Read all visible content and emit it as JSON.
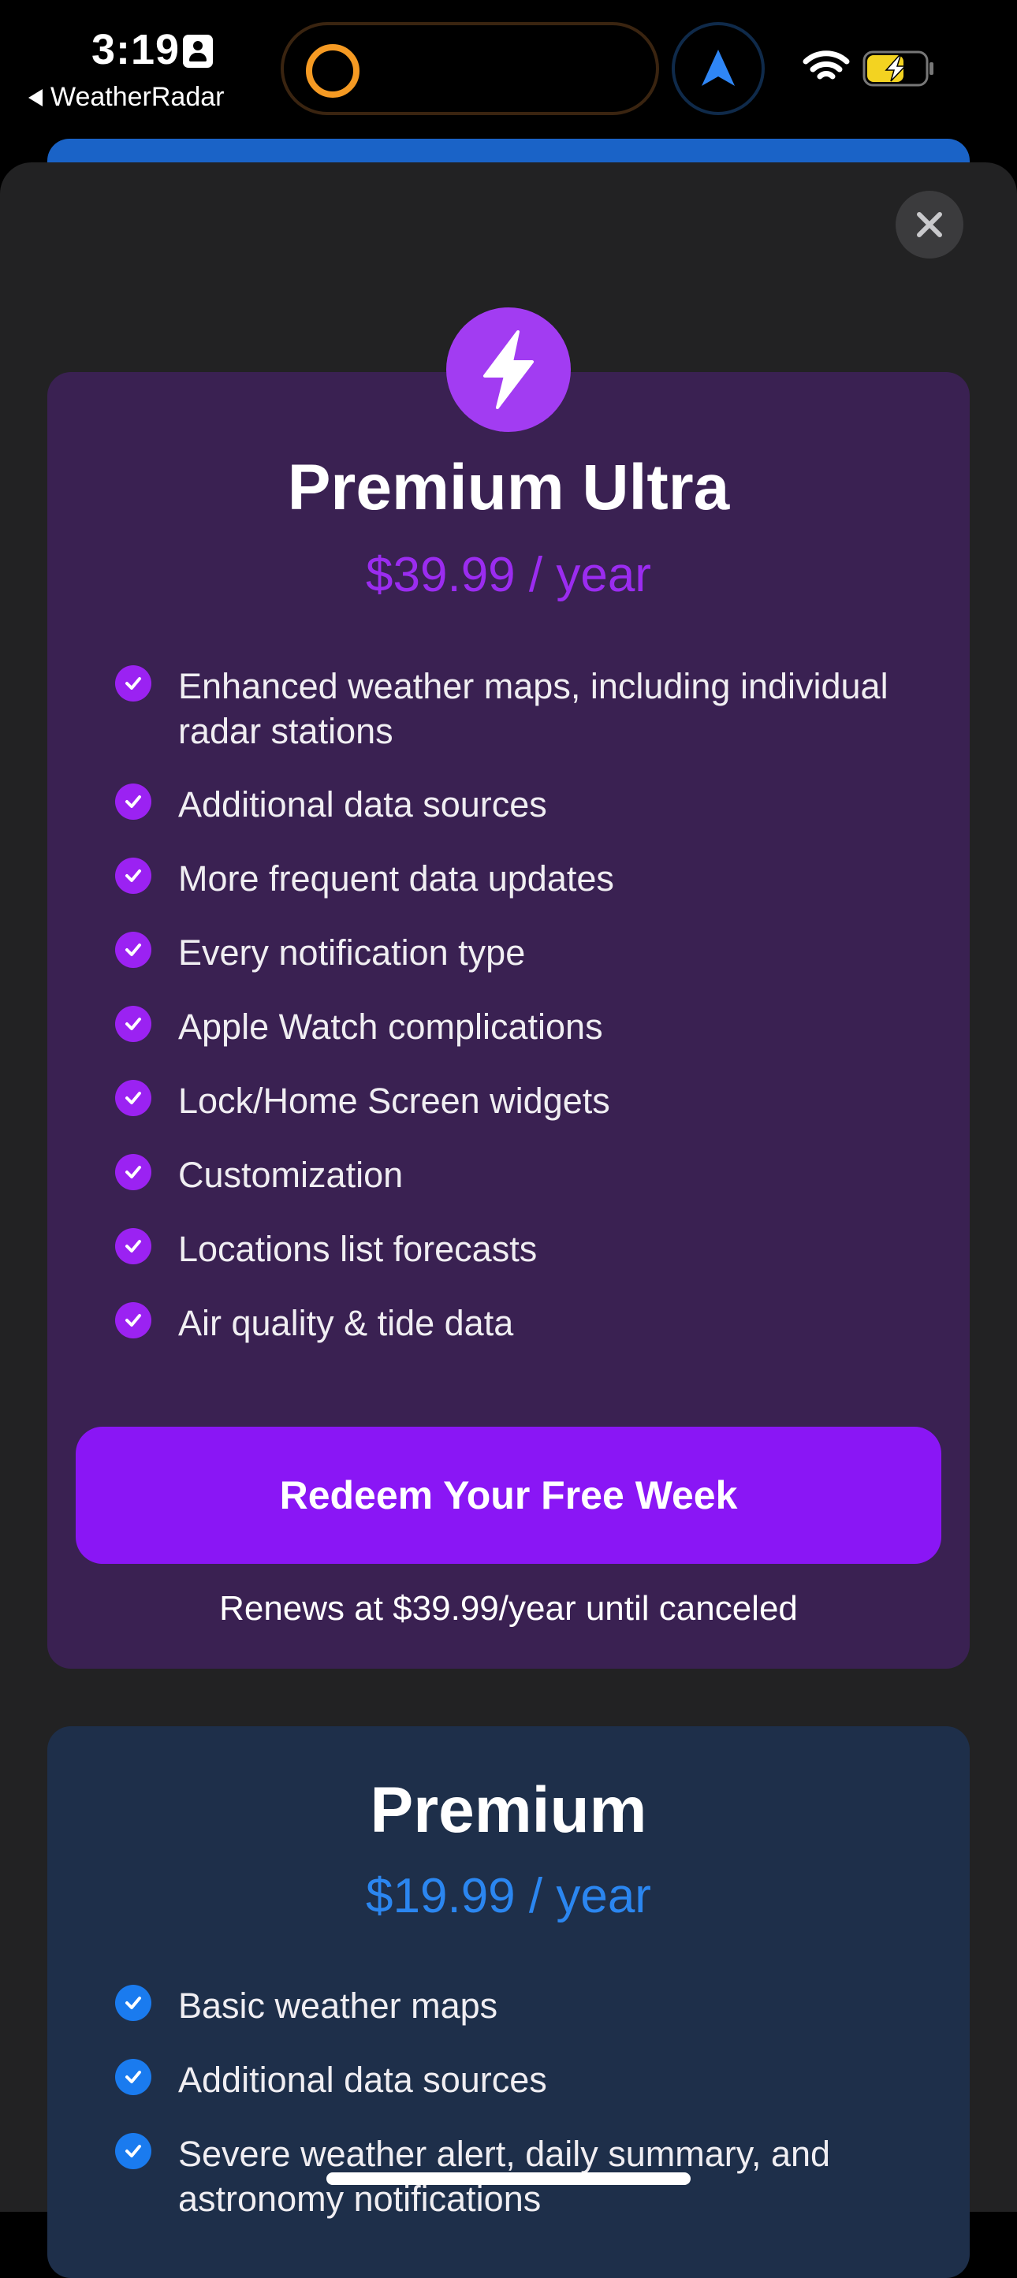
{
  "status_bar": {
    "time": "3:19",
    "back_app": "WeatherRadar"
  },
  "colors": {
    "ultra_accent": "#9b2cf0",
    "ultra_card": "#3a2152",
    "premium_accent": "#2b86f0",
    "premium_card": "#1e2f4a",
    "cta_button": "#8a16f5"
  },
  "icons": {
    "close": "close-icon",
    "ultra_badge": "lightning-bolt-icon",
    "feature_bullet": "checkmark-icon"
  },
  "ultra": {
    "title": "Premium Ultra",
    "price": "$39.99 / year",
    "features": [
      "Enhanced weather maps, including individual radar stations",
      "Additional data sources",
      "More frequent data updates",
      "Every notification type",
      "Apple Watch complications",
      "Lock/Home Screen widgets",
      "Customization",
      "Locations list forecasts",
      "Air quality & tide data"
    ],
    "cta": "Redeem Your Free Week",
    "renewal": "Renews at $39.99/year until canceled"
  },
  "premium": {
    "title": "Premium",
    "price": "$19.99 / year",
    "features": [
      "Basic weather maps",
      "Additional data sources",
      "Severe weather alert, daily summary, and astronomy notifications"
    ]
  }
}
